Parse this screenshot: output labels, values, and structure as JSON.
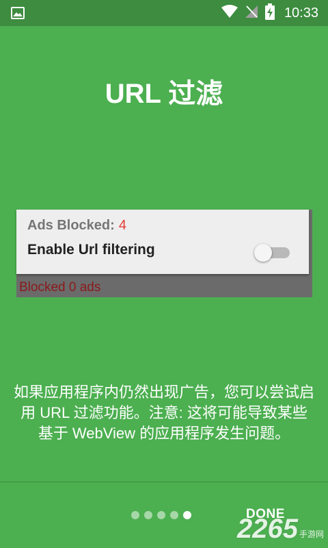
{
  "status_bar": {
    "time": "10:33",
    "icons": [
      "image-icon",
      "wifi-icon",
      "signal-off-icon",
      "battery-charging-icon"
    ]
  },
  "title": "URL 过滤",
  "card": {
    "ads_blocked_label": "Ads Blocked:",
    "ads_blocked_count": "4",
    "enable_label": "Enable Url filtering",
    "toggle_state": "off"
  },
  "blocked_text": "Blocked 0 ads",
  "description": "如果应用程序内仍然出现广告，您可以尝试启用 URL 过滤功能。注意: 这将可能导致某些基于 WebView 的应用程序发生问题。",
  "pager": {
    "total": 5,
    "current": 5
  },
  "done_label": "DONE",
  "watermark": {
    "number": "2265",
    "text": "手游网"
  },
  "colors": {
    "background": "#4caf50",
    "status_bar": "#3d8c40",
    "count": "#e53935",
    "blocked_text": "#8b1a1a"
  }
}
